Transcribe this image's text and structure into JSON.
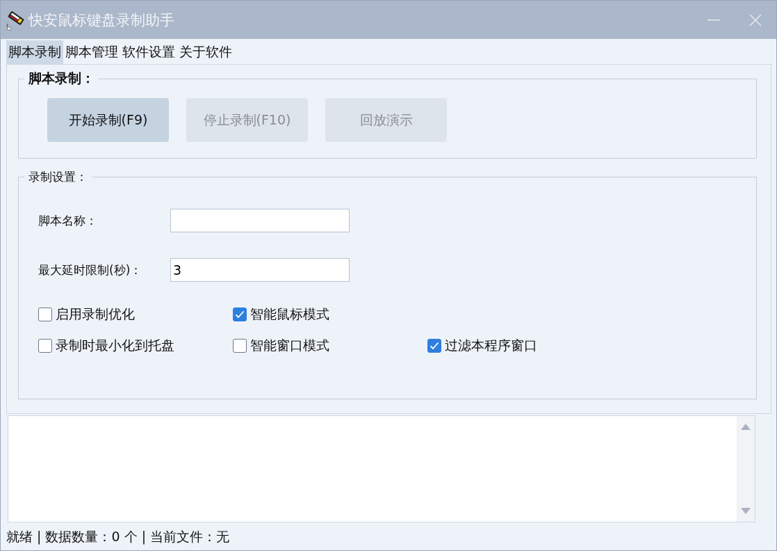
{
  "window": {
    "title": "快安鼠标键盘录制助手"
  },
  "tabs": [
    {
      "label": "脚本录制",
      "selected": true
    },
    {
      "label": "脚本管理",
      "selected": false
    },
    {
      "label": "软件设置",
      "selected": false
    },
    {
      "label": "关于软件",
      "selected": false
    }
  ],
  "record_group": {
    "title": "脚本录制：",
    "buttons": [
      {
        "label": "开始录制(F9)",
        "disabled": false
      },
      {
        "label": "停止录制(F10)",
        "disabled": true
      },
      {
        "label": "回放演示",
        "disabled": true
      }
    ]
  },
  "settings_group": {
    "title": "录制设置：",
    "fields": [
      {
        "label": "脚本名称："
      },
      {
        "label": "最大延时限制(秒)：",
        "value": "3"
      }
    ],
    "checkbox_rows": [
      [
        {
          "label": "启用录制优化",
          "checked": false
        },
        {
          "label": "智能鼠标模式",
          "checked": true
        }
      ],
      [
        {
          "label": "录制时最小化到托盘",
          "checked": false
        },
        {
          "label": "智能窗口模式",
          "checked": false
        },
        {
          "label": "过滤本程序窗口",
          "checked": true
        }
      ]
    ]
  },
  "status_bar": "就绪 | 数据数量：0 个 | 当前文件：无"
}
